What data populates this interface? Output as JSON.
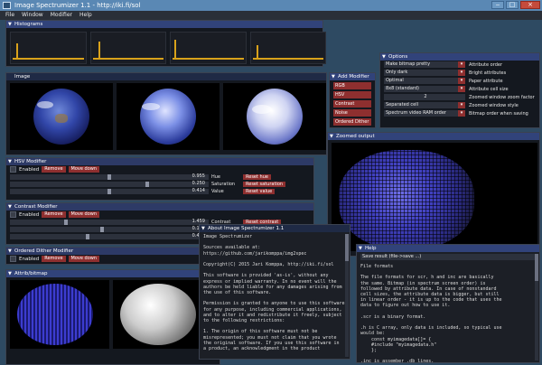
{
  "window": {
    "title": "Image Spectrumizer 1.1 - http://iki.fi/sol",
    "min": "‒",
    "max": "□",
    "close": "×"
  },
  "menu": [
    "File",
    "Window",
    "Modifier",
    "Help"
  ],
  "histograms": {
    "title": "Histograms",
    "triangle": "▼"
  },
  "image": {
    "title": "Image"
  },
  "add_modifier": {
    "title": "Add Modifier",
    "buttons": [
      "RGB",
      "HSV",
      "Contrast",
      "Noise",
      "Ordered Dither"
    ]
  },
  "options": {
    "title": "Options",
    "rows": [
      {
        "combo": "Make bitmap pretty",
        "label": "Attribute order"
      },
      {
        "combo": "Only dark",
        "label": "Bright attributes"
      },
      {
        "combo": "Optimal",
        "label": "Paper attribute"
      },
      {
        "combo": "8x8 (standard)",
        "label": "Attribute cell size"
      }
    ],
    "zoom_value": "2",
    "zoom_label": "Zoomed window zoom factor",
    "separated": "Separated cell",
    "zoom_style": "Zoomed window style",
    "spectrum_combo": "Spectrum video RAM order",
    "bitmap_order": "Bitmap order when saving",
    "arrow": "▾"
  },
  "zoomed": {
    "title": "Zoomed output"
  },
  "hsv": {
    "title": "HSV Modifier",
    "enabled": "Enabled",
    "remove": "Remove",
    "move_down": "Move down",
    "sliders": [
      {
        "value": "0.955",
        "label": "Hue",
        "reset": "Reset hue"
      },
      {
        "value": "0.250",
        "label": "Saturation",
        "reset": "Reset saturation"
      },
      {
        "value": "0.414",
        "label": "Value",
        "reset": "Reset value"
      }
    ]
  },
  "contrast": {
    "title": "Contrast Modifier",
    "enabled": "Enabled",
    "remove": "Remove",
    "move_down": "Move down",
    "sliders": [
      {
        "value": "1.459",
        "label": "Contrast",
        "reset": "Reset contrast"
      },
      {
        "value": "0.111",
        "label": ""
      },
      {
        "value": "0.411",
        "label": ""
      }
    ]
  },
  "dither": {
    "title": "Ordered Dither Modifier",
    "enabled": "Enabled",
    "remove": "Remove",
    "move_down": "Move down"
  },
  "attrib": {
    "title": "Attrib/bitmap"
  },
  "about": {
    "title": "About Image Spectrumizer 1.1",
    "text": "Image Spectrumizer\n\nSources available at:\nhttps://github.com/jarikomppa/img2spec\n\nCopyright(C) 2015 Jari Komppa, http://iki.fi/sol\n\nThis software is provided 'as-is', without any\nexpress or implied warranty. In no event will the\nauthors be held liable for any damages arising from\nthe use of this software.\n\nPermission is granted to anyone to use this software\nfor any purpose, including commercial applications,\nand to alter it and redistribute it freely, subject\nto the following restrictions:\n\n1. The origin of this software must not be\nmisrepresented; you must not claim that you wrote\nthe original software. If you use this software in\na product, an acknowledgment in the product"
  },
  "help": {
    "title": "Help",
    "input": "Save result (file->save ...)",
    "text": "File formats\n\nThe file formats for scr, h and inc are basically\nthe same. Bitmap (in spectrum screen order) is\nfollowed by attribute data. In case of nonstandard\ncell sizes, the attribute data is bigger, but still\nin linear order - it is up to the code that uses the\ndata to figure out how to use it.\n\n.scr is a binary format.\n\n.h is C array, only data is included, so typical use\nwould be:\n    const myimagedata[]= {\n    #include \"myimagedata.h\"\n    };\n\n.inc is assember .db lines."
  }
}
